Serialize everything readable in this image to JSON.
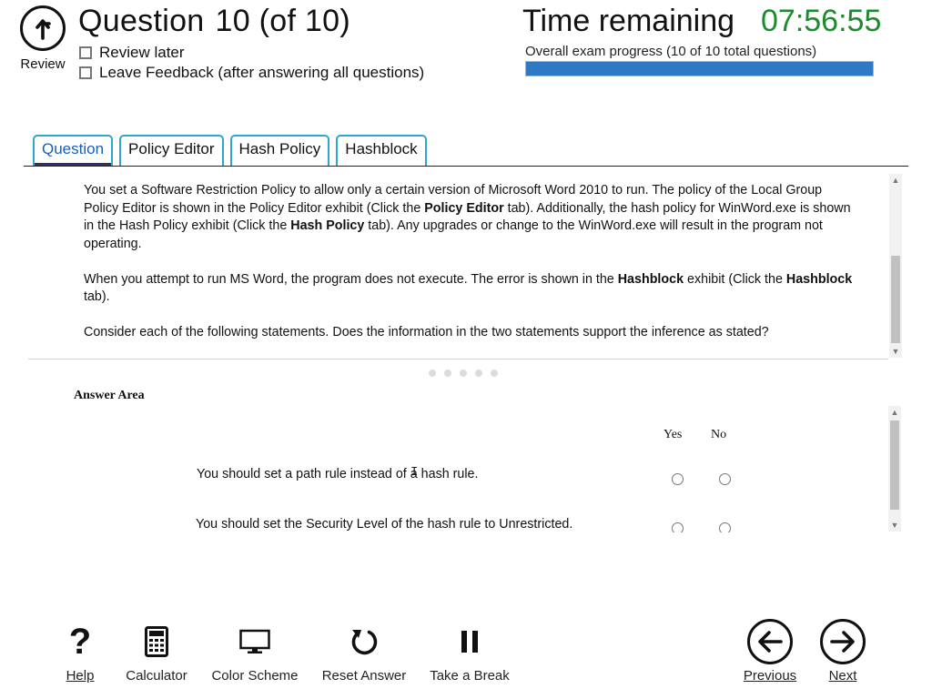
{
  "header": {
    "review_label": "Review",
    "question_word": "Question",
    "question_progress": "10 (of 10)",
    "review_later_label": "Review later",
    "feedback_label": "Leave Feedback (after answering all questions)",
    "time_label": "Time remaining",
    "time_value": "07:56:55",
    "progress_label": "Overall exam progress (10 of 10 total questions)",
    "progress_fraction": 1.0
  },
  "tabs": [
    {
      "label": "Question",
      "active": true
    },
    {
      "label": "Policy Editor",
      "active": false
    },
    {
      "label": "Hash Policy",
      "active": false
    },
    {
      "label": "Hashblock",
      "active": false
    }
  ],
  "question": {
    "p1_a": "You set a Software Restriction Policy to allow only a certain version of Microsoft Word 2010 to run. The policy of the Local Group Policy Editor is shown in the Policy Editor exhibit (Click the ",
    "p1_b": "Policy Editor",
    "p1_c": " tab). Additionally, the hash policy for WinWord.exe is shown in the Hash Policy exhibit (Click the ",
    "p1_d": "Hash Policy",
    "p1_e": " tab). Any upgrades or change to the WinWord.exe will result in the program not operating.",
    "p2_a": "When you attempt to run MS Word, the program does not execute. The error is shown in the ",
    "p2_b": "Hashblock",
    "p2_c": " exhibit (Click the ",
    "p2_d": "Hashblock",
    "p2_e": " tab).",
    "p3": "Consider each of the following statements. Does the information in the two statements support the inference as stated?"
  },
  "answer": {
    "title": "Answer Area",
    "yes_label": "Yes",
    "no_label": "No",
    "statements": [
      "You should set a path rule instead of a hash rule.",
      "You should set the Security Level of the hash rule to Unrestricted."
    ]
  },
  "toolbar": {
    "help": "Help",
    "calculator": "Calculator",
    "color_scheme": "Color Scheme",
    "reset": "Reset Answer",
    "break": "Take a Break",
    "previous": "Previous",
    "next": "Next"
  },
  "colors": {
    "timer_green": "#1d8a2e",
    "progress_blue": "#2f78c4",
    "tab_border": "#2ea6d4",
    "tab_active_underline": "#3a2a6b"
  }
}
